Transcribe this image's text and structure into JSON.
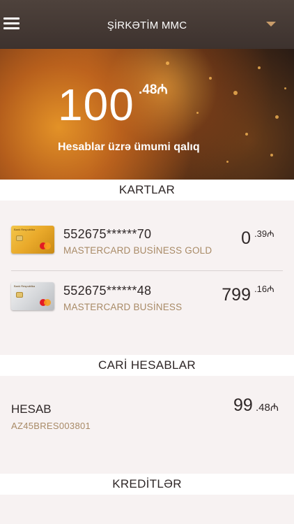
{
  "header": {
    "title": "ŞİRKƏTİM MMC",
    "menu_icon": "hamburger-menu-icon",
    "dropdown_icon": "caret-down-icon"
  },
  "balance": {
    "integer": "100",
    "fraction": ".48₼",
    "label": "Hesablar üzrə ümumi qalıq"
  },
  "sections": {
    "cards_title": "KARTLAR",
    "accounts_title": "CARİ HESABLAR",
    "credits_title": "KREDİTLƏR"
  },
  "cards": [
    {
      "number": "552675******70",
      "type": "MASTERCARD BUSİNESS GOLD",
      "amount_int": "0",
      "amount_frac": ".39₼",
      "card_style": "gold"
    },
    {
      "number": "552675******48",
      "type": "MASTERCARD BUSİNESS",
      "amount_int": "799",
      "amount_frac": ".16₼",
      "card_style": "silver"
    }
  ],
  "accounts": [
    {
      "name": "HESAB",
      "iban": "AZ45BRES003801",
      "amount_int": "99",
      "amount_frac": ".48₼"
    }
  ],
  "colors": {
    "header_bg": "#463a35",
    "accent": "#a88a66",
    "page_bg": "#f7f2f2"
  }
}
